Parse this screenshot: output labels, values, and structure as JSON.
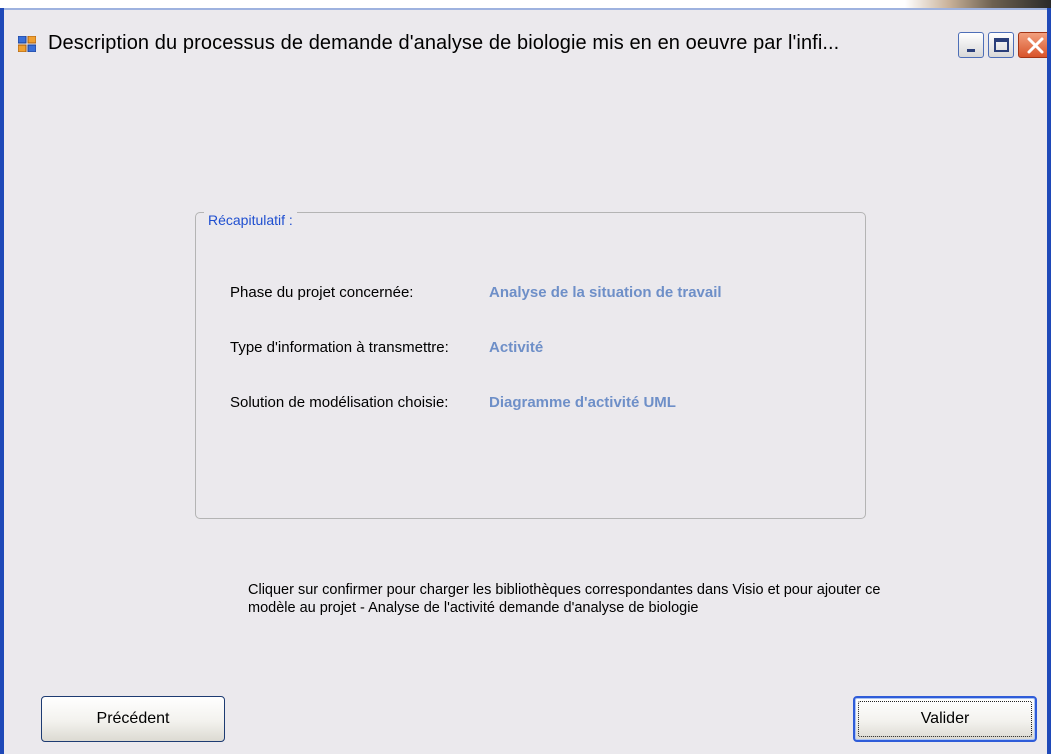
{
  "window": {
    "title": "Description du processus de demande d'analyse de biologie mis en en oeuvre par l'infi...",
    "controls": {
      "minimize_icon": "minimize-icon",
      "maximize_icon": "maximize-icon",
      "close_icon": "close-icon"
    }
  },
  "summary": {
    "legend": "Récapitulatif :",
    "rows": [
      {
        "label": "Phase du projet concernée:",
        "value": "Analyse de la situation de travail"
      },
      {
        "label": "Type d'information à transmettre:",
        "value": "Activité"
      },
      {
        "label": "Solution de modélisation choisie:",
        "value": "Diagramme d'activité UML"
      }
    ]
  },
  "info": {
    "text": "Cliquer sur confirmer pour charger les bibliothèques correspondantes dans Visio et pour ajouter ce modèle au projet - Analyse de l'activité demande d'analyse de biologie"
  },
  "buttons": {
    "previous": "Précédent",
    "validate": "Valider"
  },
  "colors": {
    "value_text": "#6e8fc8",
    "legend_text": "#1f4fd0",
    "window_frame": "#1f49b8",
    "background": "#ebe9ed"
  }
}
